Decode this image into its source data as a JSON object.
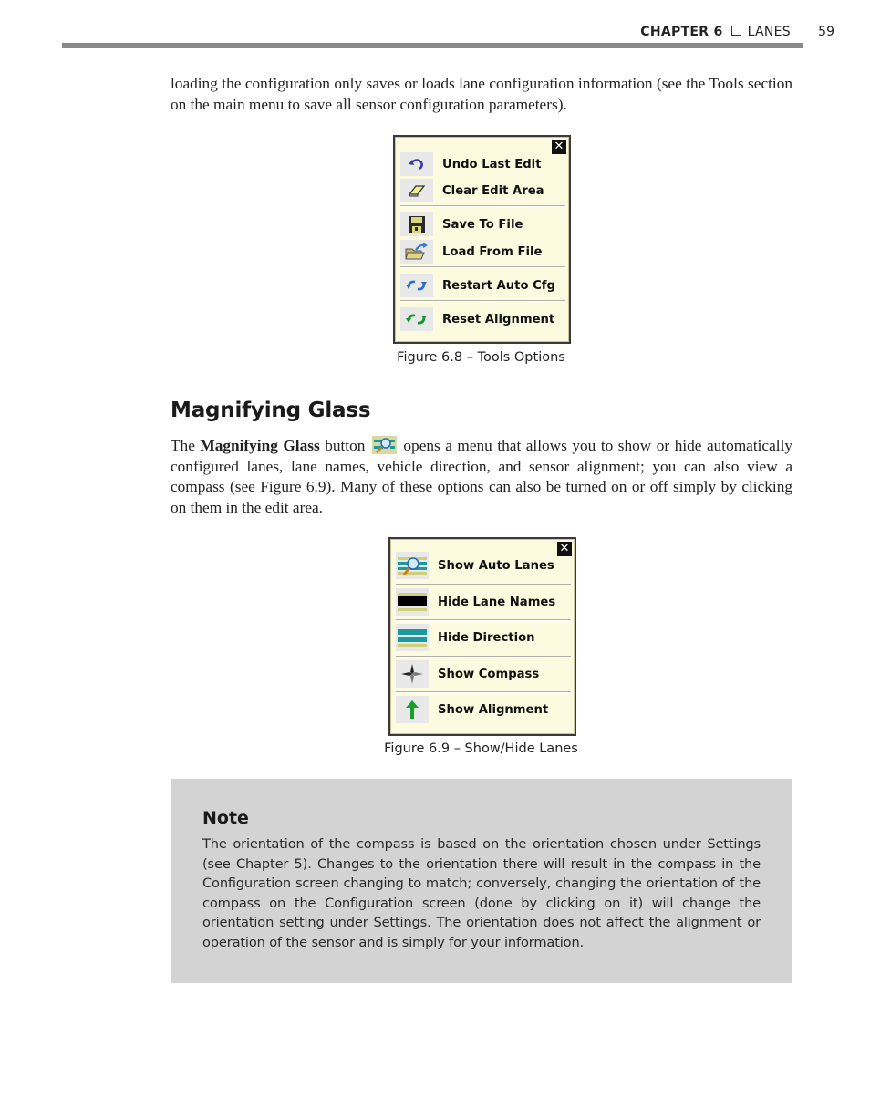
{
  "header": {
    "chapter": "CHAPTER 6",
    "section": "LANES",
    "page_number": "59"
  },
  "intro_paragraph": "loading the configuration only saves or loads lane configuration information (see the Tools section on the main menu to save all sensor configuration parameters).",
  "figure_tools": {
    "close_label": "✕",
    "items": [
      {
        "label": "Undo Last Edit",
        "icon": "undo-icon"
      },
      {
        "label": "Clear Edit Area",
        "icon": "eraser-icon"
      },
      {
        "label": "Save To File",
        "icon": "floppy-disk-icon"
      },
      {
        "label": "Load From File",
        "icon": "open-folder-icon"
      },
      {
        "label": "Restart Auto Cfg",
        "icon": "blue-refresh-arrows-icon"
      },
      {
        "label": "Reset Alignment",
        "icon": "green-refresh-arrows-icon"
      }
    ],
    "caption": "Figure 6.8 – Tools Options"
  },
  "section": {
    "title": "Magnifying Glass",
    "para_prefix": "The ",
    "para_bold": "Magnifying Glass",
    "para_mid": " button ",
    "para_suffix": " opens a menu that allows you to show or hide automatically configured lanes, lane names, vehicle direction, and sensor alignment; you can also view a compass (see Figure 6.9). Many of these options can also be turned on or off simply by clicking on them in the edit area."
  },
  "figure_lanes": {
    "close_label": "✕",
    "items": [
      {
        "label": "Show Auto Lanes",
        "icon": "magnifier-lanes-icon"
      },
      {
        "label": "Hide Lane Names",
        "icon": "black-lane-bar-icon"
      },
      {
        "label": "Hide Direction",
        "icon": "teal-lanes-icon"
      },
      {
        "label": "Show Compass",
        "icon": "compass-icon"
      },
      {
        "label": "Show Alignment",
        "icon": "green-up-arrow-icon"
      }
    ],
    "caption": "Figure 6.9 – Show/Hide Lanes"
  },
  "note": {
    "title": "Note",
    "body": "The orientation of the compass is based on the orientation chosen under Settings (see Chapter 5). Changes to the orientation there will result in the compass in the Configuration screen changing to match; conversely, changing the orientation of the compass on the Configuration screen (done by clicking on it) will change the orientation setting under Settings. The orientation does not affect the alignment or operation of the sensor and is simply for your information."
  }
}
